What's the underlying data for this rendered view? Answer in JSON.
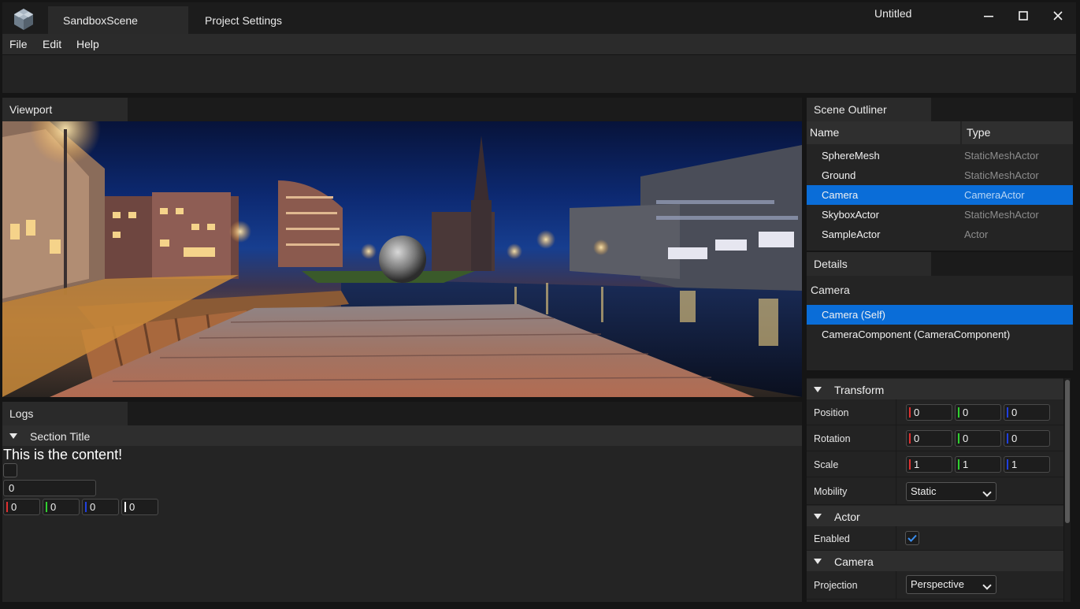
{
  "window": {
    "title": "Untitled",
    "tabs": [
      {
        "label": "SandboxScene",
        "active": true
      },
      {
        "label": "Project Settings",
        "active": false
      }
    ]
  },
  "menu": [
    "File",
    "Edit",
    "Help"
  ],
  "viewport": {
    "tab_label": "Viewport"
  },
  "logs": {
    "tab_label": "Logs",
    "section_title": "Section Title",
    "content_text": "This is the content!",
    "checkbox_checked": false,
    "number_field": "0",
    "vector4": [
      "0",
      "0",
      "0",
      "0"
    ]
  },
  "outliner": {
    "tab_label": "Scene Outliner",
    "columns": [
      "Name",
      "Type"
    ],
    "rows": [
      {
        "name": "SphereMesh",
        "type": "StaticMeshActor",
        "selected": false
      },
      {
        "name": "Ground",
        "type": "StaticMeshActor",
        "selected": false
      },
      {
        "name": "Camera",
        "type": "CameraActor",
        "selected": true
      },
      {
        "name": "SkyboxActor",
        "type": "StaticMeshActor",
        "selected": false
      },
      {
        "name": "SampleActor",
        "type": "Actor",
        "selected": false
      }
    ]
  },
  "details": {
    "tab_label": "Details",
    "actor_name": "Camera",
    "components": [
      {
        "label": "Camera (Self)",
        "selected": true
      },
      {
        "label": "CameraComponent (CameraComponent)",
        "selected": false
      }
    ],
    "transform": {
      "title": "Transform",
      "position_label": "Position",
      "position": [
        "0",
        "0",
        "0"
      ],
      "rotation_label": "Rotation",
      "rotation": [
        "0",
        "0",
        "0"
      ],
      "scale_label": "Scale",
      "scale": [
        "1",
        "1",
        "1"
      ],
      "mobility_label": "Mobility",
      "mobility": "Static"
    },
    "actor": {
      "title": "Actor",
      "enabled_label": "Enabled",
      "enabled": true
    },
    "camera": {
      "title": "Camera",
      "projection_label": "Projection",
      "projection": "Perspective"
    }
  },
  "colors": {
    "accent": "#0a6dd8",
    "axis_x": "#e03030",
    "axis_y": "#30d030",
    "axis_z": "#2040e0",
    "axis_w": "#ffffff"
  }
}
